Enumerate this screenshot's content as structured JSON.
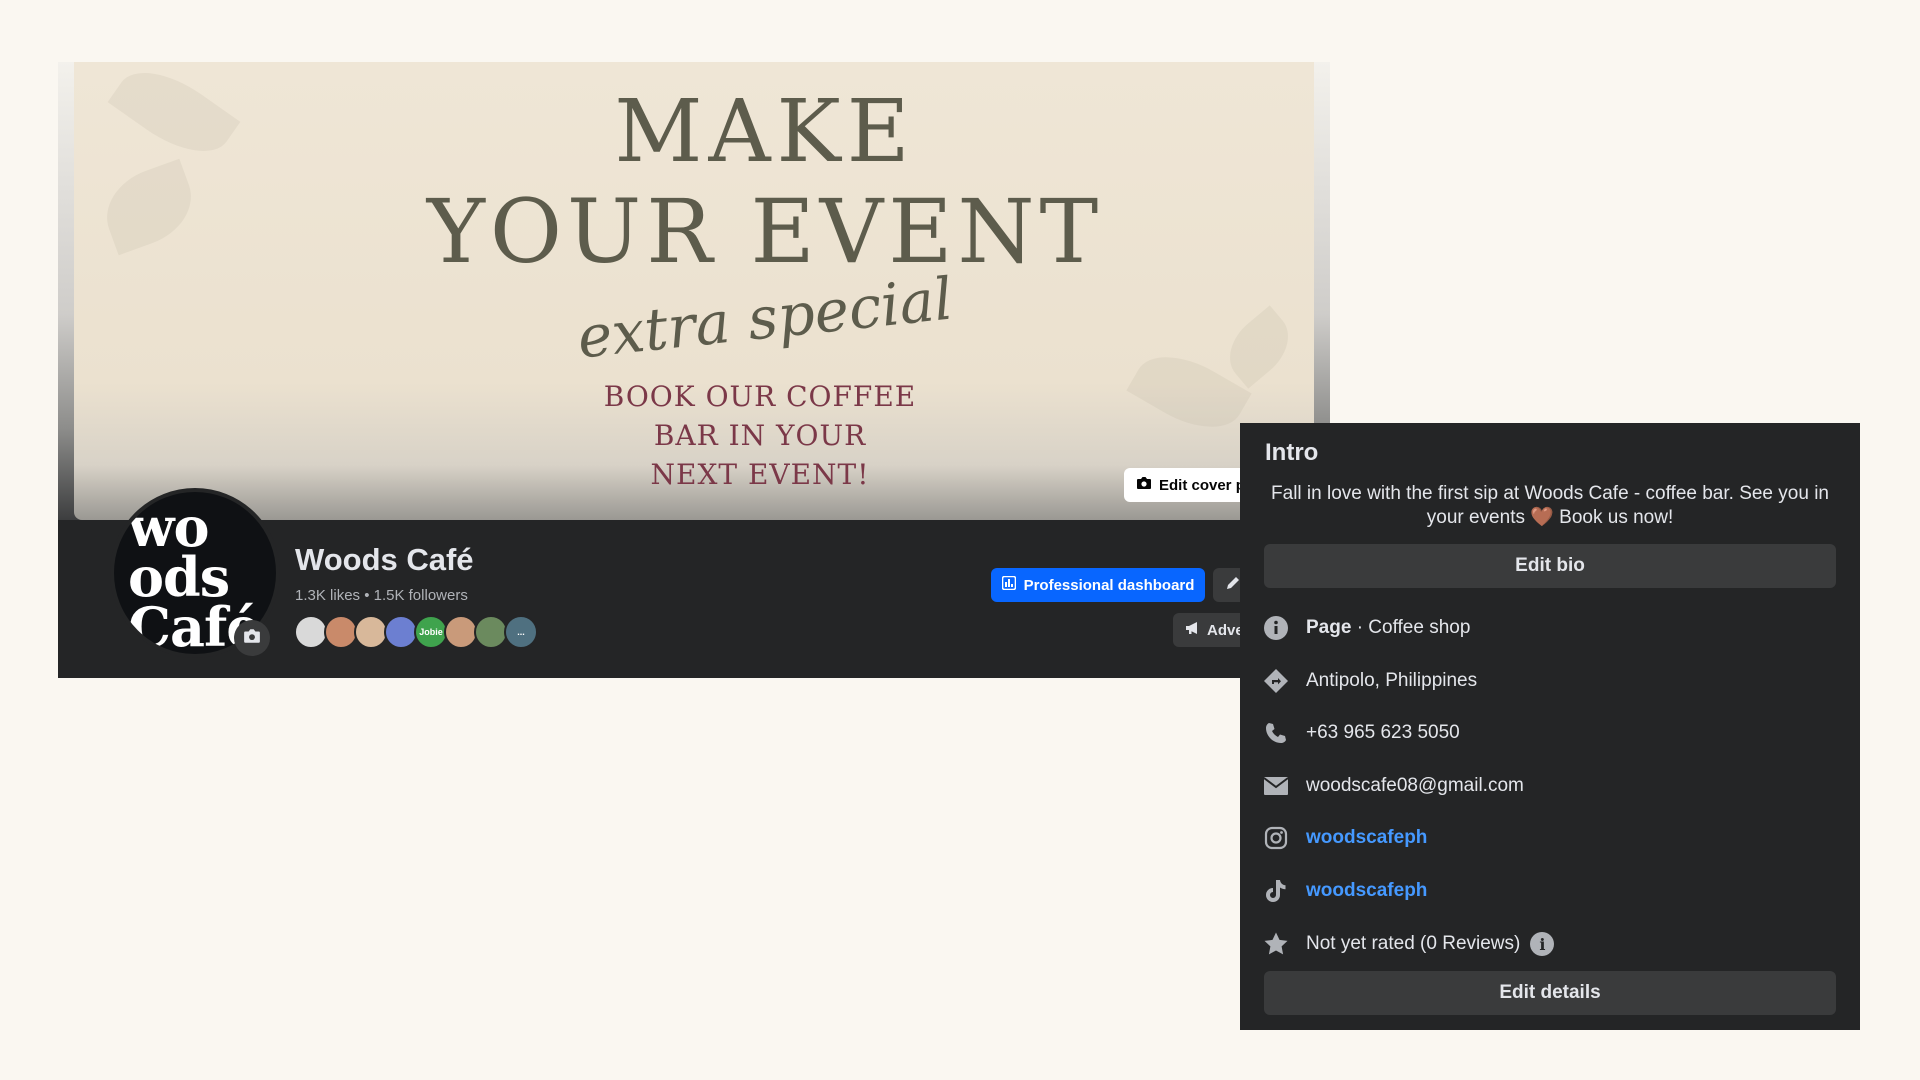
{
  "cover": {
    "line1": "MAKE",
    "line2": "YOUR EVENT",
    "script": "extra special",
    "small1": "BOOK OUR COFFEE",
    "small2": "BAR IN YOUR",
    "small3": "NEXT EVENT!",
    "edit_cover_label": "Edit cover photo"
  },
  "profile": {
    "avatar_text_1": "wo",
    "avatar_text_2": "ods",
    "avatar_text_3": "Café",
    "name": "Woods Café",
    "stats": "1.3K likes • 1.5K followers",
    "follower_avatar_text": [
      "",
      "",
      "",
      "",
      "Jobie",
      "",
      "",
      "..."
    ],
    "follower_colors": [
      "#d9d9d9",
      "#c98a6a",
      "#d8b89a",
      "#6c7fd1",
      "#3fa34d",
      "#c99a7a",
      "#6b8a5e",
      "#4f7080"
    ]
  },
  "actions": {
    "professional_dashboard": "Professional dashboard",
    "advertise": "Advertise"
  },
  "intro": {
    "title": "Intro",
    "bio_line1": "Fall in love with the first sip at Woods Cafe - coffee bar. See you in",
    "bio_line2": "your events 🤎 Book us now!",
    "edit_bio": "Edit bio",
    "page_label": "Page",
    "page_category": " · Coffee shop",
    "location": "Antipolo, Philippines",
    "phone": "+63 965 623 5050",
    "email": "woodscafe08@gmail.com",
    "instagram": "woodscafeph",
    "tiktok": "woodscafeph",
    "rating": "Not yet rated (0 Reviews)",
    "edit_details": "Edit details"
  },
  "colors": {
    "accent_blue": "#0866ff",
    "link_blue": "#4599ff",
    "panel_bg": "#242526",
    "button_bg": "#3a3b3c"
  }
}
